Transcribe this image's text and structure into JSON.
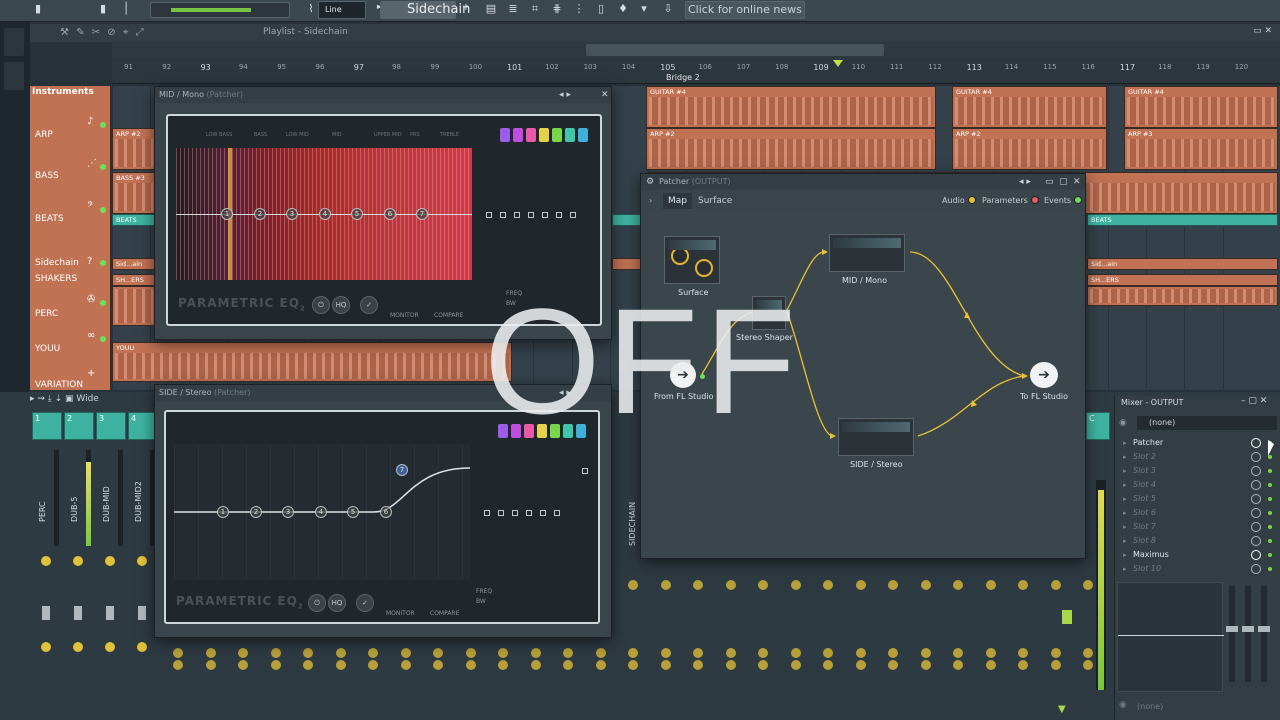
{
  "toolbar": {
    "snap_mode": "Line",
    "pattern": "Sidechain",
    "news": "Click for online news"
  },
  "playlist": {
    "title": "Playlist - Sidechain",
    "ruler": [
      "91",
      "92",
      "93",
      "94",
      "95",
      "96",
      "97",
      "98",
      "99",
      "100",
      "101",
      "102",
      "103",
      "104",
      "105",
      "106",
      "107",
      "108",
      "109",
      "110",
      "111",
      "112",
      "113",
      "114",
      "115",
      "116",
      "117",
      "118",
      "119",
      "120"
    ],
    "marker": "Bridge 2",
    "instruments_header": "Instruments",
    "tracks": [
      "ARP",
      "BASS",
      "BEATS",
      "Sidechain",
      "SHAKERS",
      "PERC",
      "YOUU",
      "VARIATION"
    ],
    "clips": {
      "guitar": "GUITAR #4",
      "arp": "ARP #2",
      "arp3": "ARP #3",
      "bass": "BASS #3",
      "beats": "BEATS",
      "sidechain": "Sid...ain",
      "shakers": "SH...ERS",
      "youu": "YOUU"
    }
  },
  "mixer": {
    "mode": "Wide",
    "channels": [
      "1",
      "2",
      "3",
      "4"
    ],
    "strips": [
      "PERC",
      "DUB-5",
      "DUB-MID",
      "DUB-MID2"
    ],
    "sidechain_strip": "SIDECHAIN",
    "c_label": "C"
  },
  "eq_mid": {
    "window_title": "MID / Mono",
    "window_sub": "(Patcher)",
    "brand": "PARAMETRIC EQ",
    "brand_sub": "2",
    "bands": [
      "LOW BASS",
      "BASS",
      "LOW MID",
      "MID",
      "UPPER MID",
      "PRS",
      "TREBLE"
    ],
    "nodes": [
      "1",
      "2",
      "3",
      "4",
      "5",
      "6",
      "7"
    ],
    "buttons": {
      "hq": "HQ",
      "monitor": "MONITOR",
      "compare": "COMPARE"
    },
    "freq": "FREQ",
    "bw": "BW"
  },
  "eq_side": {
    "window_title": "SIDE / Stereo",
    "window_sub": "(Patcher)",
    "brand": "PARAMETRIC EQ",
    "brand_sub": "2",
    "nodes": [
      "1",
      "2",
      "3",
      "4",
      "5",
      "6",
      "7"
    ],
    "buttons": {
      "hq": "HQ",
      "monitor": "MONITOR",
      "compare": "COMPARE"
    },
    "freq": "FREQ",
    "bw": "BW"
  },
  "patcher": {
    "window_title": "Patcher",
    "window_sub": "(OUTPUT)",
    "tabs": [
      "Map",
      "Surface"
    ],
    "legend": {
      "audio": "Audio",
      "parameters": "Parameters",
      "events": "Events"
    },
    "legend_colors": {
      "audio": "#e8c233",
      "parameters": "#e05a6a",
      "events": "#6de05a"
    },
    "nodes": {
      "surface": "Surface",
      "mid": "MID / Mono",
      "stereo": "Stereo Shaper",
      "from": "From FL Studio",
      "to": "To FL Studio",
      "side": "SIDE / Stereo"
    }
  },
  "mixer_output": {
    "title": "Mixer - OUTPUT",
    "input": "(none)",
    "output": "(none)",
    "slots": [
      {
        "name": "Patcher",
        "filled": true
      },
      {
        "name": "Slot 2",
        "filled": false
      },
      {
        "name": "Slot 3",
        "filled": false
      },
      {
        "name": "Slot 4",
        "filled": false
      },
      {
        "name": "Slot 5",
        "filled": false
      },
      {
        "name": "Slot 6",
        "filled": false
      },
      {
        "name": "Slot 7",
        "filled": false
      },
      {
        "name": "Slot 8",
        "filled": false
      },
      {
        "name": "Maximus",
        "filled": true
      },
      {
        "name": "Slot 10",
        "filled": false
      }
    ]
  },
  "overlay": "OFF"
}
